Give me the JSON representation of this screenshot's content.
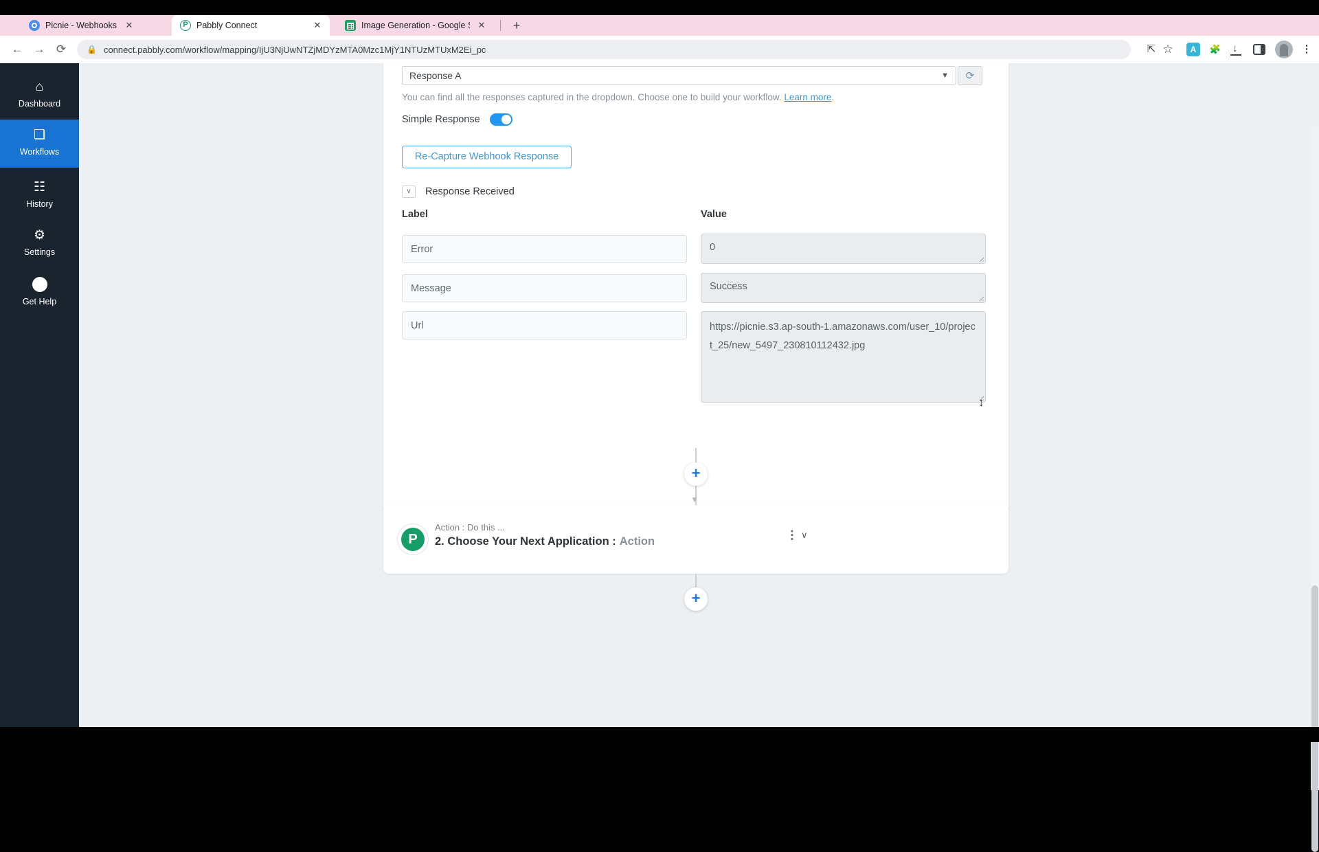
{
  "colors": {
    "accent_blue": "#1a73e8",
    "pabbly_green": "#159f67",
    "sidebar_bg": "#1a242f",
    "sidebar_active_blue": "#1873d3",
    "tab_strip_pink": "#f6d9e4",
    "canvas_bg": "#edf0f3",
    "toggle_on_blue": "#2196f3"
  },
  "browser": {
    "tabs": [
      {
        "title": "Picnie - Webhooks",
        "close_glyph": "✕"
      },
      {
        "title": "Pabbly Connect",
        "close_glyph": "✕"
      },
      {
        "title": "Image Generation - Google Shee",
        "close_glyph": "✕"
      }
    ],
    "new_tab_glyph": "+",
    "back_glyph": "←",
    "forward_glyph": "→",
    "reload_glyph": "⟳",
    "lock_glyph": "🔒",
    "url": "connect.pabbly.com/workflow/mapping/IjU3NjUwNTZjMDYzMTA0Mzc1MjY1NTUzMTUxM2Ei_pc",
    "share_glyph": "⇱",
    "star_glyph": "☆",
    "teal_extension_glyph": "A",
    "puzzle_glyph": "🧩",
    "kebab_glyph": "⋮"
  },
  "sidebar": {
    "items": [
      {
        "label": "Dashboard",
        "icon": "⌂"
      },
      {
        "label": "Workflows",
        "icon": "❑"
      },
      {
        "label": "History",
        "icon": "☷"
      },
      {
        "label": "Settings",
        "icon": "⚙"
      },
      {
        "label": "Get Help",
        "icon": "?"
      }
    ]
  },
  "panel": {
    "response_select_value": "Response A",
    "select_caret": "▼",
    "refresh_glyph": "⟳",
    "helper_text": "You can find all the responses captured in the dropdown. Choose one to build your workflow.",
    "learn_more_label": "Learn more",
    "helper_period": ".",
    "simple_response_label": "Simple Response",
    "recapture_button_label": "Re-Capture Webhook Response",
    "section_chevron": "∨",
    "section_label": "Response Received",
    "table": {
      "label_header": "Label",
      "value_header": "Value",
      "rows": [
        {
          "label": "Error",
          "value": "0"
        },
        {
          "label": "Message",
          "value": "Success"
        },
        {
          "label": "Url",
          "value": "https://picnie.s3.ap-south-1.amazonaws.com/user_10/project_25/new_5497_230810112432.jpg"
        }
      ]
    }
  },
  "connector": {
    "plus_glyph": "+",
    "arrow_glyph": "▼"
  },
  "action_card": {
    "kicker": "Action : Do this ...",
    "title": "2. Choose Your Next Application :",
    "title_suffix": "Action",
    "kebab_glyph": "⋮",
    "chevron_glyph": "∨"
  },
  "cursor_glyph": "↕"
}
